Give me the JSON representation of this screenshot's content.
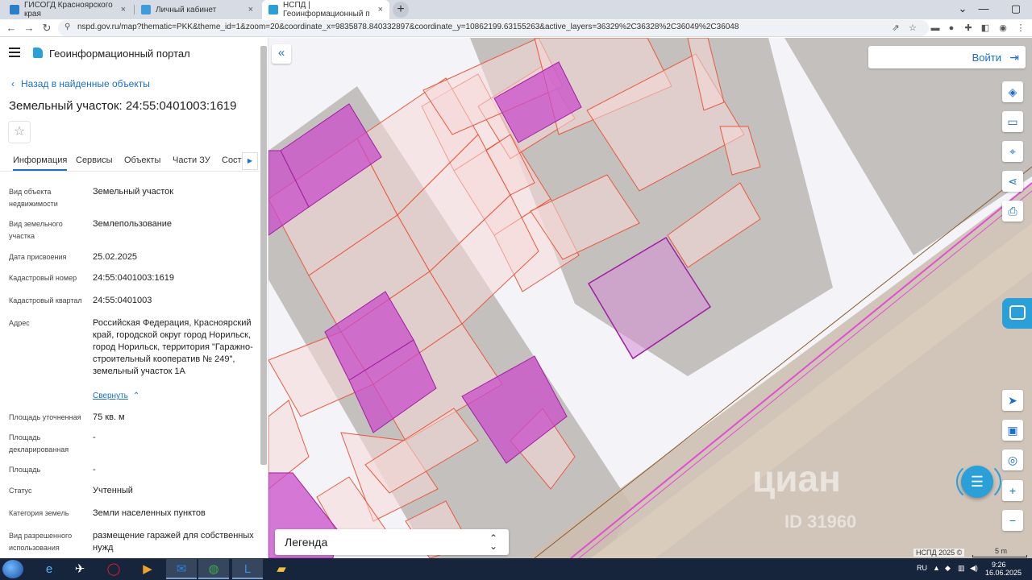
{
  "browser": {
    "tabs": [
      {
        "title": "ГИСОГД Красноярского края",
        "active": false
      },
      {
        "title": "Личный кабинет",
        "active": false
      },
      {
        "title": "НСПД | Геоинформационный п",
        "active": true
      }
    ],
    "close_glyph": "×",
    "new_tab_glyph": "+",
    "url": "nspd.gov.ru/map?thematic=PKK&theme_id=1&zoom=20&coordinate_x=9835878.840332897&coordinate_y=10862199.63155263&active_layers=36329%2C36328%2C36049%2C36048"
  },
  "sidebar": {
    "portal_title": "Геоинформационный портал",
    "back_link": "Назад в найденные объекты",
    "object_title": "Земельный участок: 24:55:0401003:1619",
    "tabs": [
      "Информация",
      "Сервисы",
      "Объекты",
      "Части ЗУ",
      "Соста"
    ],
    "properties": [
      {
        "label": "Вид объекта недвижимости",
        "value": "Земельный участок"
      },
      {
        "label": "Вид земельного участка",
        "value": "Землепользование"
      },
      {
        "label": "Дата присвоения",
        "value": "25.02.2025"
      },
      {
        "label": "Кадастровый номер",
        "value": "24:55:0401003:1619"
      },
      {
        "label": "Кадастровый квартал",
        "value": "24:55:0401003"
      },
      {
        "label": "Адрес",
        "value": "Российская Федерация, Красноярский край, городской округ город Норильск, город Норильск, территория \"Гаражно-строительный кооператив № 249\", земельный участок 1А"
      },
      {
        "label": "Площадь уточненная",
        "value": "75 кв. м"
      },
      {
        "label": "Площадь декларированная",
        "value": "-"
      },
      {
        "label": "Площадь",
        "value": "-"
      },
      {
        "label": "Статус",
        "value": "Учтенный"
      },
      {
        "label": "Категория земель",
        "value": "Земли населенных пунктов"
      },
      {
        "label": "Вид разрешенного использования",
        "value": "размещение гаражей для собственных нужд"
      }
    ],
    "collapse_link": "Свернуть"
  },
  "map": {
    "login_label": "Войти",
    "legend_label": "Легенда",
    "copyright": "НСПД 2025 ©",
    "scale_label": "5 m",
    "watermark": "циан",
    "watermark_id": "ID 31960"
  },
  "colors": {
    "accent": "#1a6fc8",
    "parcel_fill": "#f5d9d9",
    "parcel_stroke": "#e8593f",
    "building_fill": "#a3a09b",
    "selected_fill": "#c94ec9"
  },
  "taskbar": {
    "lang": "RU",
    "time": "9:26",
    "date": "16.06.2025"
  }
}
